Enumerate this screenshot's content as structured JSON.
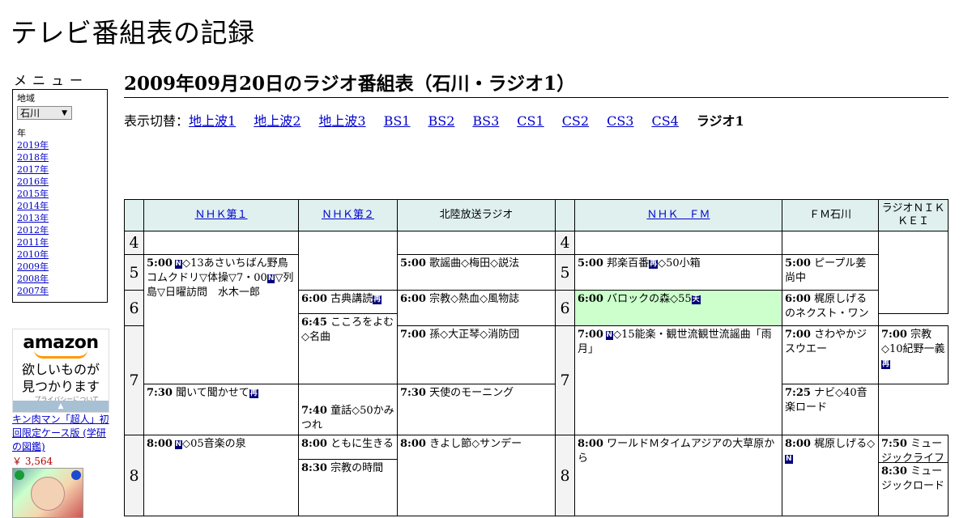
{
  "site": {
    "title": "テレビ番組表の記録"
  },
  "menu": {
    "title": "メニュー",
    "region_label": "地域",
    "region_value": "石川",
    "year_label": "年",
    "years": [
      "2019年",
      "2018年",
      "2017年",
      "2016年",
      "2015年",
      "2014年",
      "2013年",
      "2012年",
      "2011年",
      "2010年",
      "2009年",
      "2008年",
      "2007年"
    ]
  },
  "ad": {
    "logo": "amazon",
    "tagline_1": "欲しいものが",
    "tagline_2": "見つかります",
    "privacy": "プライバシーについて",
    "arrow": "▲",
    "product": "キン肉マン「超人」初回限定ケース版 (学研の図鑑)",
    "price": "￥ 3,564"
  },
  "page": {
    "heading": "2009年09月20日のラジオ番組表（石川・ラジオ1）",
    "switch_label": "表示切替：",
    "switch_links": [
      "地上波1",
      "地上波2",
      "地上波3",
      "BS1",
      "BS2",
      "BS3",
      "CS1",
      "CS2",
      "CS3",
      "CS4"
    ],
    "switch_current": "ラジオ1"
  },
  "channels": {
    "nhk1": "ＮＨＫ第１",
    "nhk2": "ＮＨＫ第２",
    "mro": "北陸放送ラジオ",
    "nhkfm": "ＮＨＫ　ＦＭ",
    "fmishikawa": "ＦＭ石川",
    "nikkei": "ラジオＮＩＫＫＥＩ"
  },
  "hours": [
    "4",
    "5",
    "6",
    "7",
    "8"
  ],
  "badges": {
    "news": "N",
    "rebroadcast": "再",
    "weather": "天"
  },
  "programs": {
    "nhk1_500_time": "5:00",
    "nhk1_500_a": "◇13あさいちばん野鳥コムクドリ▽体操▽7・00",
    "nhk1_500_b": "▽列島▽日曜訪問　水木一郎",
    "nhk1_800_time": "8:00",
    "nhk1_800": "◇05音楽の泉",
    "nhk2_600_time": "6:00",
    "nhk2_600": "古典講読",
    "nhk2_645_time": "6:45",
    "nhk2_645": "こころをよむ◇名曲",
    "nhk2_730_time": "7:30",
    "nhk2_730": "聞いて聞かせて",
    "nhk2_800_time": "8:00",
    "nhk2_800": "ともに生きる",
    "nhk2_830_time": "8:30",
    "nhk2_830": "宗教の時間",
    "mro_500_time": "5:00",
    "mro_500": "歌謡曲◇梅田◇説法",
    "mro_600_time": "6:00",
    "mro_600": "宗教◇熱血◇風物誌",
    "mro_700_time": "7:00",
    "mro_700": "孫◇大正琴◇消防団",
    "mro_740_time": "7:40",
    "mro_740": "童話◇50かみつれ",
    "mro_800_time": "8:00",
    "mro_800": "きよし節◇サンデー",
    "fm_500_time": "5:00",
    "fm_500_a": "邦楽百番",
    "fm_500_b": "◇50小箱",
    "fm_600_time": "6:00",
    "fm_600": "バロックの森◇55",
    "fm_700_time": "7:00",
    "fm_700": "◇15能楽・観世流観世流謡曲「雨月」",
    "fm_800_time": "8:00",
    "fm_800": "ワールドＭタイムアジアの大草原から",
    "fmi_500_time": "5:00",
    "fmi_500": "ピープル姜尚中",
    "fmi_600_time": "6:00",
    "fmi_600": "梶原しげるのネクスト・ワン",
    "fmi_700_time": "7:00",
    "fmi_700": "さわやかジスウエー",
    "fmi_730_time": "7:30",
    "fmi_730": "天使のモーニング",
    "fmi_800_time": "8:00",
    "fmi_800": "梶原しげる◇",
    "nk_700_time": "7:00",
    "nk_700": "宗教◇10紀野一義",
    "nk_725_time": "7:25",
    "nk_725": "ナビ◇40音楽ロード",
    "nk_750_time": "7:50",
    "nk_750": "ミュージックライフ",
    "nk_830_time": "8:30",
    "nk_830": "ミュージックロード"
  }
}
